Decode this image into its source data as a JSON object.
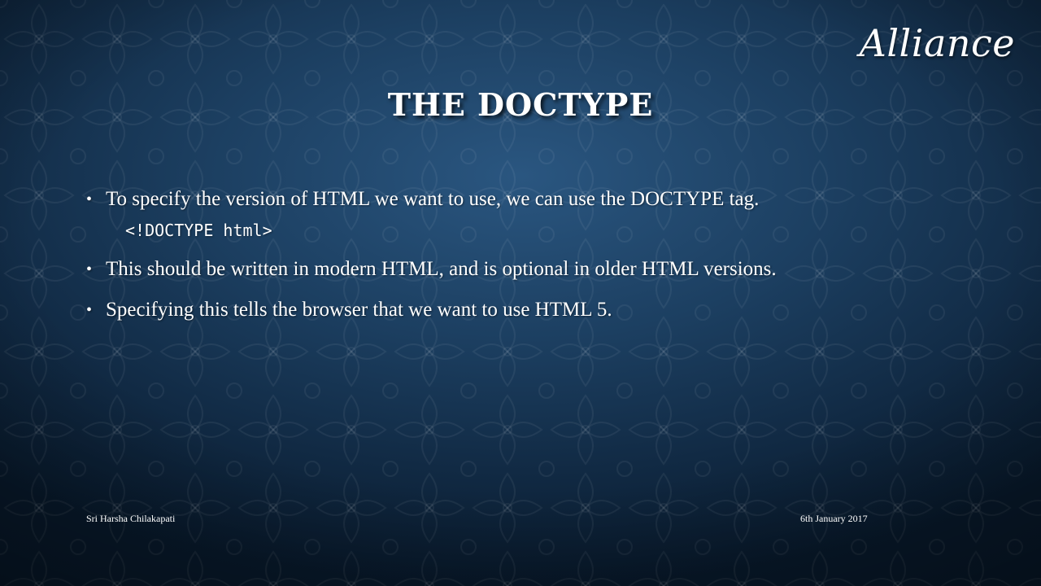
{
  "slide": {
    "logo_text": "Alliance",
    "title": "THE DOCTYPE",
    "bullets": [
      "To specify the version of HTML we want to use, we can use the DOCTYPE tag.",
      "This should be written in modern HTML, and is optional in older HTML versions.",
      "Specifying this tells the browser that we want to use HTML 5."
    ],
    "code_line": "<!DOCTYPE html>",
    "footer_left": "Sri Harsha Chilakapati",
    "footer_right": "6th January 2017",
    "bullet_glyph": "•"
  },
  "colors": {
    "background_center": "#2a5680",
    "background_edge": "#08192b",
    "text": "#ffffff"
  }
}
